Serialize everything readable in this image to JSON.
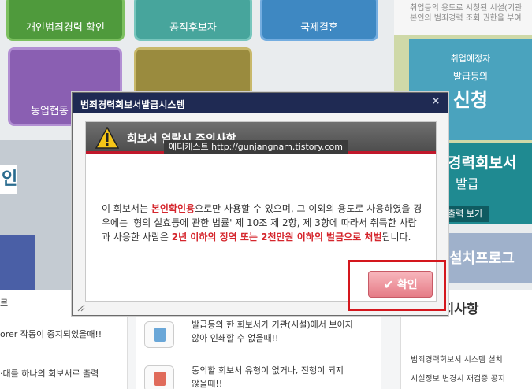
{
  "background": {
    "tiles": {
      "criminal_check": "개인범죄경력 확인",
      "candidate": "공직후보자",
      "marriage": "국제결혼",
      "agriculture": "농업협동"
    },
    "notice_text": [
      "취업등의 용도로 시청된 시설(기관",
      "본인의 범죄경력 조회 권한을 부여"
    ],
    "job_box": {
      "line1": "취업예정자",
      "line2": "발급등의",
      "line3": "신청"
    },
    "left_chip": "인",
    "reg_panel": {
      "title": "경력회보서",
      "subtitle": "발급",
      "button": "출력 보기"
    },
    "install_panel": {
      "title": "설치프로그"
    },
    "bottom_left": {
      "label_top": "르",
      "item1": "orer 작동이 중지되었을때!!",
      "item2": "·대를 하나의 회보서로 출력"
    },
    "bottom_mid": {
      "item1": [
        "발급등의 한 회보서가 기관(시설)에서 보이지",
        "않아 인쇄할 수 없을때!!"
      ],
      "item2": [
        "동의할 회보서 유형이 없거나, 진행이 되지",
        "않을때!!"
      ]
    },
    "bottom_right": {
      "heading": "공지사항",
      "items": [
        "범죄경력회보서 시스템 설치",
        "시설정보 변경시 재검증 공지"
      ]
    }
  },
  "modal": {
    "window_title": "범죄경력회보서발급시스템",
    "close_label": "×",
    "header_title": "회보서 열람시 주의사항",
    "watermark": "에디캐스트 http://gunjangnam.tistory.com",
    "message": {
      "part1": "이 회보서는 ",
      "highlight1": "본인확인용",
      "part2": "으로만 사용할 수 있으며, 그 이외의 용도로 사용하였을 경우에는 '형의 실효등에 관한 법률' 제 10조 제 2항, 제 3항에 따라서 취득한 사람과 사용한 사람은 ",
      "highlight2": "2년 이하의 징역 또는 2천만원 이하의 벌금으로 처벌",
      "part3": "됩니다."
    },
    "confirm_label": "확인"
  }
}
